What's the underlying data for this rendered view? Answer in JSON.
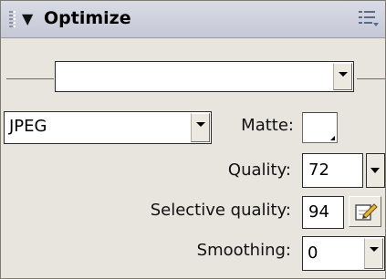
{
  "panel": {
    "title": "Optimize",
    "collapse_icon": "triangle-down-icon",
    "menu_icon": "options-menu-icon"
  },
  "settings": {
    "value": ""
  },
  "format": {
    "value": "JPEG"
  },
  "matte": {
    "label": "Matte:",
    "color": "#ffffff"
  },
  "quality": {
    "label": "Quality:",
    "value": "72"
  },
  "selective_quality": {
    "label": "Selective quality:",
    "value": "94",
    "edit_icon": "edit-pencil-icon"
  },
  "smoothing": {
    "label": "Smoothing:",
    "value": "0"
  }
}
